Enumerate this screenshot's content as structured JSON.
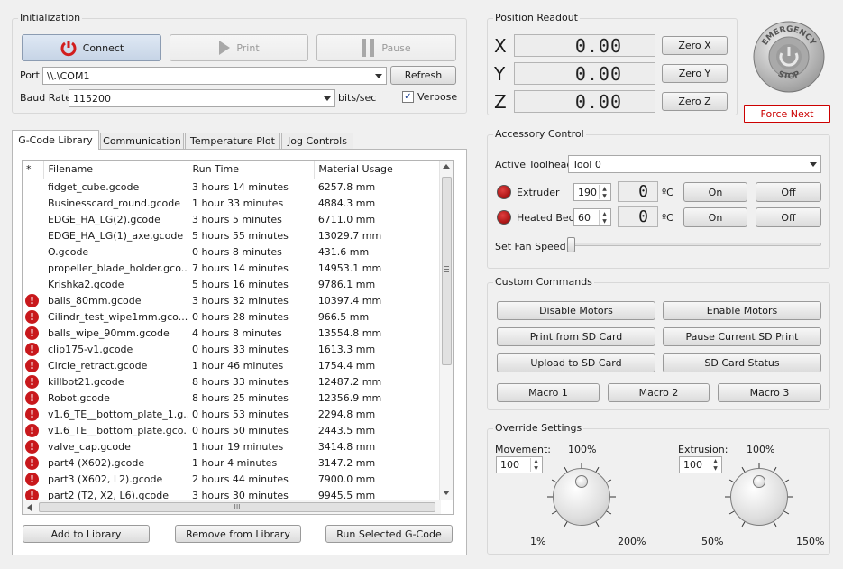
{
  "initialization": {
    "title": "Initialization",
    "connect_label": "Connect",
    "print_label": "Print",
    "pause_label": "Pause",
    "port_label": "Port",
    "port_value": "\\\\.\\COM1",
    "refresh_label": "Refresh",
    "baud_label": "Baud Rate",
    "baud_value": "115200",
    "baud_unit": "bits/sec",
    "verbose_label": "Verbose",
    "verbose_checked": true,
    "connect_icon_color": "#d21e1e"
  },
  "position": {
    "title": "Position Readout",
    "axes": [
      {
        "axis": "X",
        "value": "0.00",
        "zero_label": "Zero X"
      },
      {
        "axis": "Y",
        "value": "0.00",
        "zero_label": "Zero Y"
      },
      {
        "axis": "Z",
        "value": "0.00",
        "zero_label": "Zero Z"
      }
    ]
  },
  "emergency": {
    "top_text": "EMERGENCY",
    "bottom_text": "STOP",
    "force_next_label": "Force Next",
    "force_next_color": "#cc0000"
  },
  "tabs": [
    "G-Code Library",
    "Communication",
    "Temperature Plot",
    "Jog Controls"
  ],
  "library": {
    "columns": [
      "*",
      "Filename",
      "Run Time",
      "Material Usage"
    ],
    "rows": [
      {
        "warn": false,
        "filename": "fidget_cube.gcode",
        "run_time": "3 hours 14 minutes",
        "material": "6257.8 mm"
      },
      {
        "warn": false,
        "filename": "Businesscard_round.gcode",
        "run_time": "1 hour 33 minutes",
        "material": "4884.3 mm"
      },
      {
        "warn": false,
        "filename": "EDGE_HA_LG(2).gcode",
        "run_time": "3 hours 5 minutes",
        "material": "6711.0 mm"
      },
      {
        "warn": false,
        "filename": "EDGE_HA_LG(1)_axe.gcode",
        "run_time": "5 hours 55 minutes",
        "material": "13029.7 mm"
      },
      {
        "warn": false,
        "filename": "O.gcode",
        "run_time": "0 hours 8 minutes",
        "material": "431.6 mm"
      },
      {
        "warn": false,
        "filename": "propeller_blade_holder.gco...",
        "run_time": "7 hours 14 minutes",
        "material": "14953.1 mm"
      },
      {
        "warn": false,
        "filename": "Krishka2.gcode",
        "run_time": "5 hours 16 minutes",
        "material": "9786.1 mm"
      },
      {
        "warn": true,
        "filename": "balls_80mm.gcode",
        "run_time": "3 hours 32 minutes",
        "material": "10397.4 mm"
      },
      {
        "warn": true,
        "filename": "Cilindr_test_wipe1mm.gco...",
        "run_time": "0 hours 28 minutes",
        "material": "966.5 mm"
      },
      {
        "warn": true,
        "filename": "balls_wipe_90mm.gcode",
        "run_time": "4 hours 8 minutes",
        "material": "13554.8 mm"
      },
      {
        "warn": true,
        "filename": "clip175-v1.gcode",
        "run_time": "0 hours 33 minutes",
        "material": "1613.3 mm"
      },
      {
        "warn": true,
        "filename": "Circle_retract.gcode",
        "run_time": "1 hour 46 minutes",
        "material": "1754.4 mm"
      },
      {
        "warn": true,
        "filename": "killbot21.gcode",
        "run_time": "8 hours 33 minutes",
        "material": "12487.2 mm"
      },
      {
        "warn": true,
        "filename": "Robot.gcode",
        "run_time": "8 hours 25 minutes",
        "material": "12356.9 mm"
      },
      {
        "warn": true,
        "filename": "v1.6_TE__bottom_plate_1.g...",
        "run_time": "0 hours 53 minutes",
        "material": "2294.8 mm"
      },
      {
        "warn": true,
        "filename": "v1.6_TE__bottom_plate.gco...",
        "run_time": "0 hours 50 minutes",
        "material": "2443.5 mm"
      },
      {
        "warn": true,
        "filename": "valve_cap.gcode",
        "run_time": "1 hour 19 minutes",
        "material": "3414.8 mm"
      },
      {
        "warn": true,
        "filename": "part4 (X602).gcode",
        "run_time": "1 hour 4 minutes",
        "material": "3147.2 mm"
      },
      {
        "warn": true,
        "filename": "part3 (X602, L2).gcode",
        "run_time": "2 hours 44 minutes",
        "material": "7900.0 mm"
      },
      {
        "warn": true,
        "filename": "part2 (T2, X2, L6).gcode",
        "run_time": "3 hours 30 minutes",
        "material": "9945.5 mm"
      }
    ],
    "warn_symbol": "!",
    "hscroll_grip": "III",
    "add_label": "Add to Library",
    "remove_label": "Remove from Library",
    "run_label": "Run Selected G-Code"
  },
  "accessory": {
    "title": "Accessory Control",
    "toolhead_label": "Active Toolhead",
    "toolhead_value": "Tool 0",
    "extruder_label": "Extruder",
    "extruder_setpoint": "190",
    "extruder_reading": "0",
    "bed_label": "Heated Bed",
    "bed_setpoint": "60",
    "bed_reading": "0",
    "unit": "ºC",
    "on_label": "On",
    "off_label": "Off",
    "fan_label": "Set Fan Speed",
    "fan_speed": 0,
    "indicator_color": "#b01818"
  },
  "custom": {
    "title": "Custom Commands",
    "buttons": [
      "Disable Motors",
      "Enable Motors",
      "Print from SD Card",
      "Pause Current SD Print",
      "Upload to SD Card",
      "SD Card Status"
    ],
    "macros": [
      "Macro 1",
      "Macro 2",
      "Macro 3"
    ]
  },
  "override": {
    "title": "Override Settings",
    "movement_label": "Movement:",
    "movement_value": "100",
    "movement_top": "100%",
    "movement_min": "1%",
    "movement_max": "200%",
    "extrusion_label": "Extrusion:",
    "extrusion_value": "100",
    "extrusion_top": "100%",
    "extrusion_min": "50%",
    "extrusion_max": "150%"
  }
}
